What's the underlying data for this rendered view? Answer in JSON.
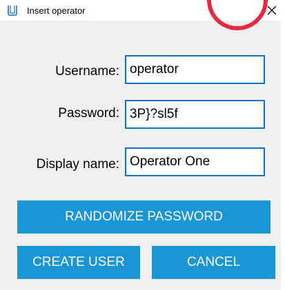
{
  "window": {
    "title": "Insert operator",
    "close_glyph": "✕",
    "app_icon": "app-icon"
  },
  "form": {
    "username": {
      "label": "Username:",
      "value": "operator"
    },
    "password": {
      "label": "Password:",
      "value": "3P}?sl5f"
    },
    "display_name": {
      "label": "Display name:",
      "value": "Operator One"
    }
  },
  "buttons": {
    "randomize": "RANDOMIZE PASSWORD",
    "create_user": "CREATE USER",
    "cancel": "CANCEL"
  },
  "colors": {
    "button_bg": "#1a95d5",
    "input_border": "#0a6fd0",
    "window_bg": "#f0f0f0",
    "accent_red": "#e8283e"
  }
}
